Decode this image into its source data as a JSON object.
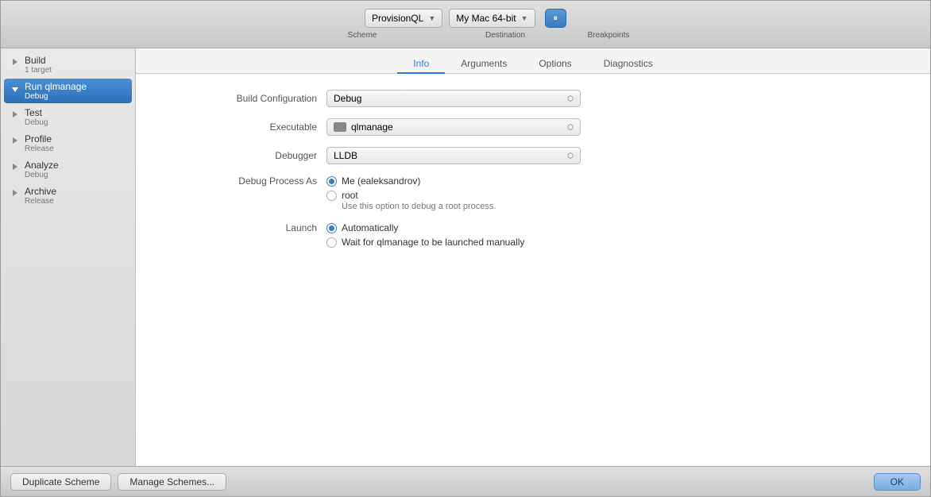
{
  "toolbar": {
    "scheme_label": "Scheme",
    "destination_label": "Destination",
    "breakpoints_label": "Breakpoints",
    "scheme_value": "ProvisionQL",
    "destination_value": "My Mac 64-bit"
  },
  "sidebar": {
    "items": [
      {
        "id": "build",
        "name": "Build",
        "sub": "1 target",
        "selected": false
      },
      {
        "id": "run-qlmanage",
        "name": "Run qlmanage",
        "sub": "Debug",
        "selected": true
      },
      {
        "id": "test",
        "name": "Test",
        "sub": "Debug",
        "selected": false
      },
      {
        "id": "profile",
        "name": "Profile",
        "sub": "Release",
        "selected": false
      },
      {
        "id": "analyze",
        "name": "Analyze",
        "sub": "Debug",
        "selected": false
      },
      {
        "id": "archive",
        "name": "Archive",
        "sub": "Release",
        "selected": false
      }
    ]
  },
  "tabs": [
    {
      "id": "info",
      "label": "Info",
      "active": true
    },
    {
      "id": "arguments",
      "label": "Arguments",
      "active": false
    },
    {
      "id": "options",
      "label": "Options",
      "active": false
    },
    {
      "id": "diagnostics",
      "label": "Diagnostics",
      "active": false
    }
  ],
  "form": {
    "build_configuration_label": "Build Configuration",
    "build_configuration_value": "Debug",
    "executable_label": "Executable",
    "executable_value": "qlmanage",
    "debugger_label": "Debugger",
    "debugger_value": "LLDB",
    "debug_process_as_label": "Debug Process As",
    "debug_process_me_label": "Me (ealeksandrov)",
    "debug_process_root_label": "root",
    "debug_process_root_sub": "Use this option to debug a root process.",
    "launch_label": "Launch",
    "launch_auto_label": "Automatically",
    "launch_wait_label": "Wait for qlmanage to be launched manually"
  },
  "bottom": {
    "duplicate_label": "Duplicate Scheme",
    "manage_label": "Manage Schemes...",
    "ok_label": "OK"
  }
}
